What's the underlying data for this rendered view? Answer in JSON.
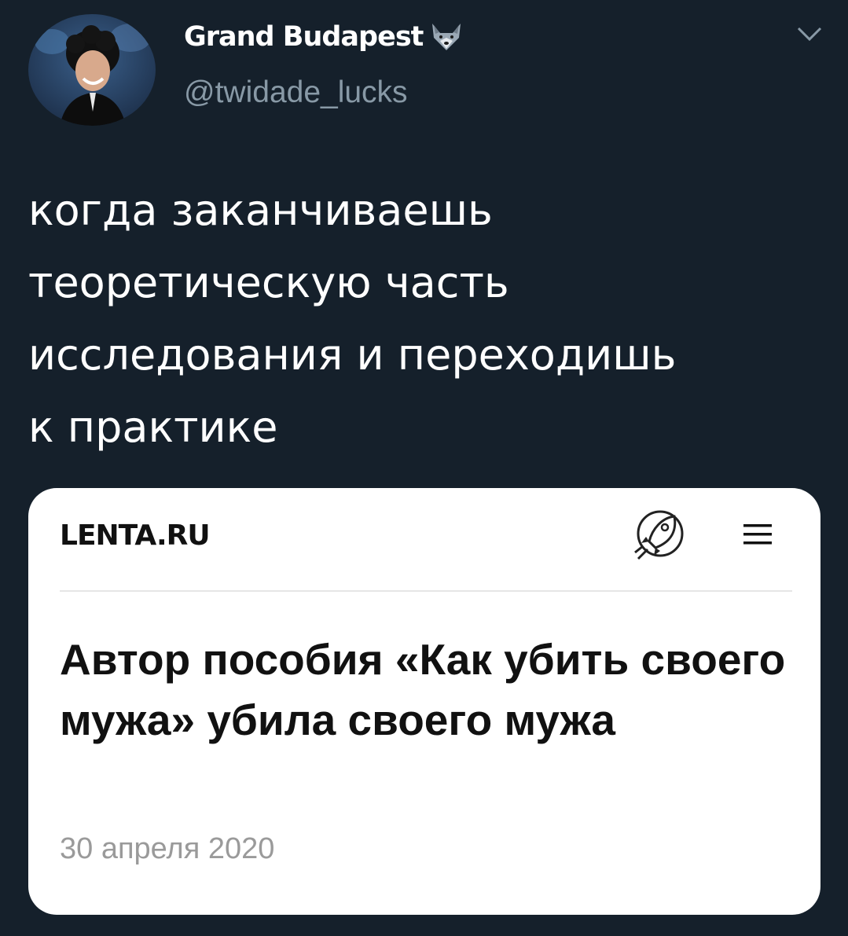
{
  "tweet": {
    "display_name": "Grand Budapest",
    "name_emoji": "wolf-face-icon",
    "handle": "@twidade_lucks",
    "text": "когда заканчиваешь\nтеоретическую часть\nисследования и переходишь\nк практике"
  },
  "card": {
    "site_logo": "LENTA.RU",
    "rocket_icon": "rocket-icon",
    "menu_icon": "hamburger-menu-icon",
    "headline": "Автор пособия «Как убить своего мужа» убила своего мужа",
    "date": "30 апреля 2020"
  },
  "colors": {
    "background": "#15202b",
    "primary_text": "#ffffff",
    "secondary_text": "#8899a6",
    "card_background": "#ffffff",
    "headline_text": "#111111",
    "date_text": "#9a9a9a"
  }
}
